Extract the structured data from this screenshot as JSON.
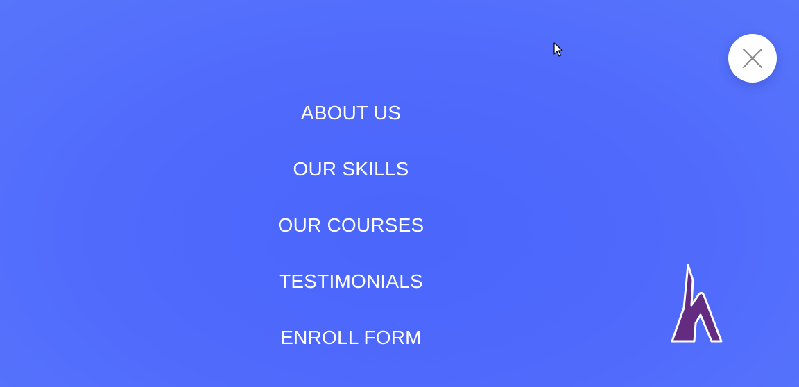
{
  "menu": {
    "items": [
      {
        "label": "ABOUT US"
      },
      {
        "label": "OUR SKILLS"
      },
      {
        "label": "OUR COURSES"
      },
      {
        "label": "TESTIMONIALS"
      },
      {
        "label": "ENROLL FORM"
      }
    ]
  },
  "controls": {
    "close_icon": "close-icon",
    "logo_icon": "h-logo-icon",
    "cursor_icon": "mouse-pointer-icon"
  },
  "colors": {
    "background": "#4f69fc",
    "text": "#ffffff",
    "close_bg": "#ffffff",
    "close_x": "#8a8a8a",
    "logo_fill": "#632c80",
    "logo_outline": "#ffffff"
  }
}
